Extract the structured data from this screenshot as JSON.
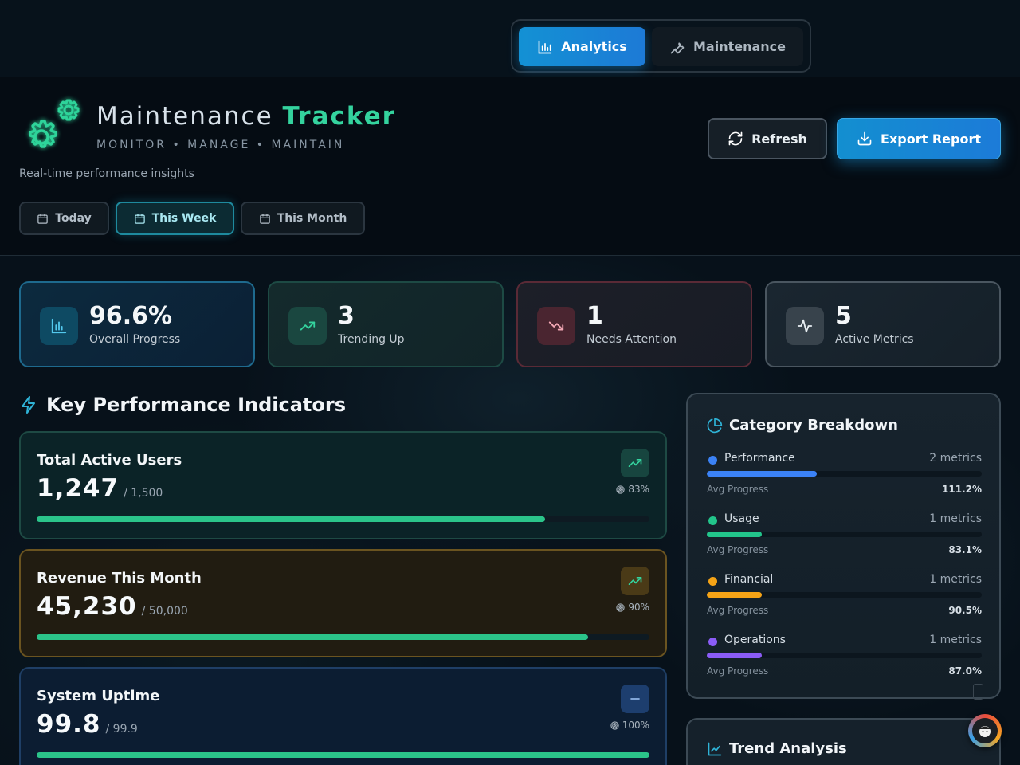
{
  "nav": {
    "tabs": [
      {
        "label": "Analytics",
        "active": true,
        "icon": "bar-chart-icon"
      },
      {
        "label": "Maintenance",
        "active": false,
        "icon": "wrench-icon"
      }
    ]
  },
  "header": {
    "title_main": "Maintenance",
    "title_accent": "Tracker",
    "subtitle": "MONITOR • MANAGE • MAINTAIN",
    "tagline": "Real-time performance insights",
    "refresh_label": "Refresh",
    "export_label": "Export Report",
    "periods": [
      {
        "label": "Today",
        "active": false
      },
      {
        "label": "This Week",
        "active": true
      },
      {
        "label": "This Month",
        "active": false
      }
    ]
  },
  "stats": [
    {
      "value": "96.6%",
      "label": "Overall Progress",
      "icon": "bar-chart-icon"
    },
    {
      "value": "3",
      "label": "Trending Up",
      "icon": "trending-up-icon"
    },
    {
      "value": "1",
      "label": "Needs Attention",
      "icon": "trending-down-icon"
    },
    {
      "value": "5",
      "label": "Active Metrics",
      "icon": "activity-icon"
    }
  ],
  "kpi": {
    "heading": "Key Performance Indicators",
    "items": [
      {
        "title": "Total Active Users",
        "value": "1,247",
        "target": "/ 1,500",
        "percent": "83%",
        "progress": 83,
        "trend": "up"
      },
      {
        "title": "Revenue This Month",
        "value": "45,230",
        "target": "/ 50,000",
        "percent": "90%",
        "progress": 90,
        "trend": "up"
      },
      {
        "title": "System Uptime",
        "value": "99.8",
        "target": "/ 99.9",
        "percent": "100%",
        "progress": 100,
        "trend": "flat"
      }
    ]
  },
  "categories": {
    "heading": "Category Breakdown",
    "avg_label": "Avg Progress",
    "items": [
      {
        "name": "Performance",
        "count": "2 metrics",
        "avg": "111.2%",
        "progress": 40,
        "color": "#3b82f6"
      },
      {
        "name": "Usage",
        "count": "1 metrics",
        "avg": "83.1%",
        "progress": 20,
        "color": "#22c58b"
      },
      {
        "name": "Financial",
        "count": "1 metrics",
        "avg": "90.5%",
        "progress": 20,
        "color": "#f5a316"
      },
      {
        "name": "Operations",
        "count": "1 metrics",
        "avg": "87.0%",
        "progress": 20,
        "color": "#8b5cf6"
      }
    ]
  },
  "trend": {
    "heading": "Trend Analysis"
  },
  "colors": {
    "accent_green": "#34d39e",
    "accent_blue": "#1391d4",
    "progress_green": "#2bc48a"
  }
}
